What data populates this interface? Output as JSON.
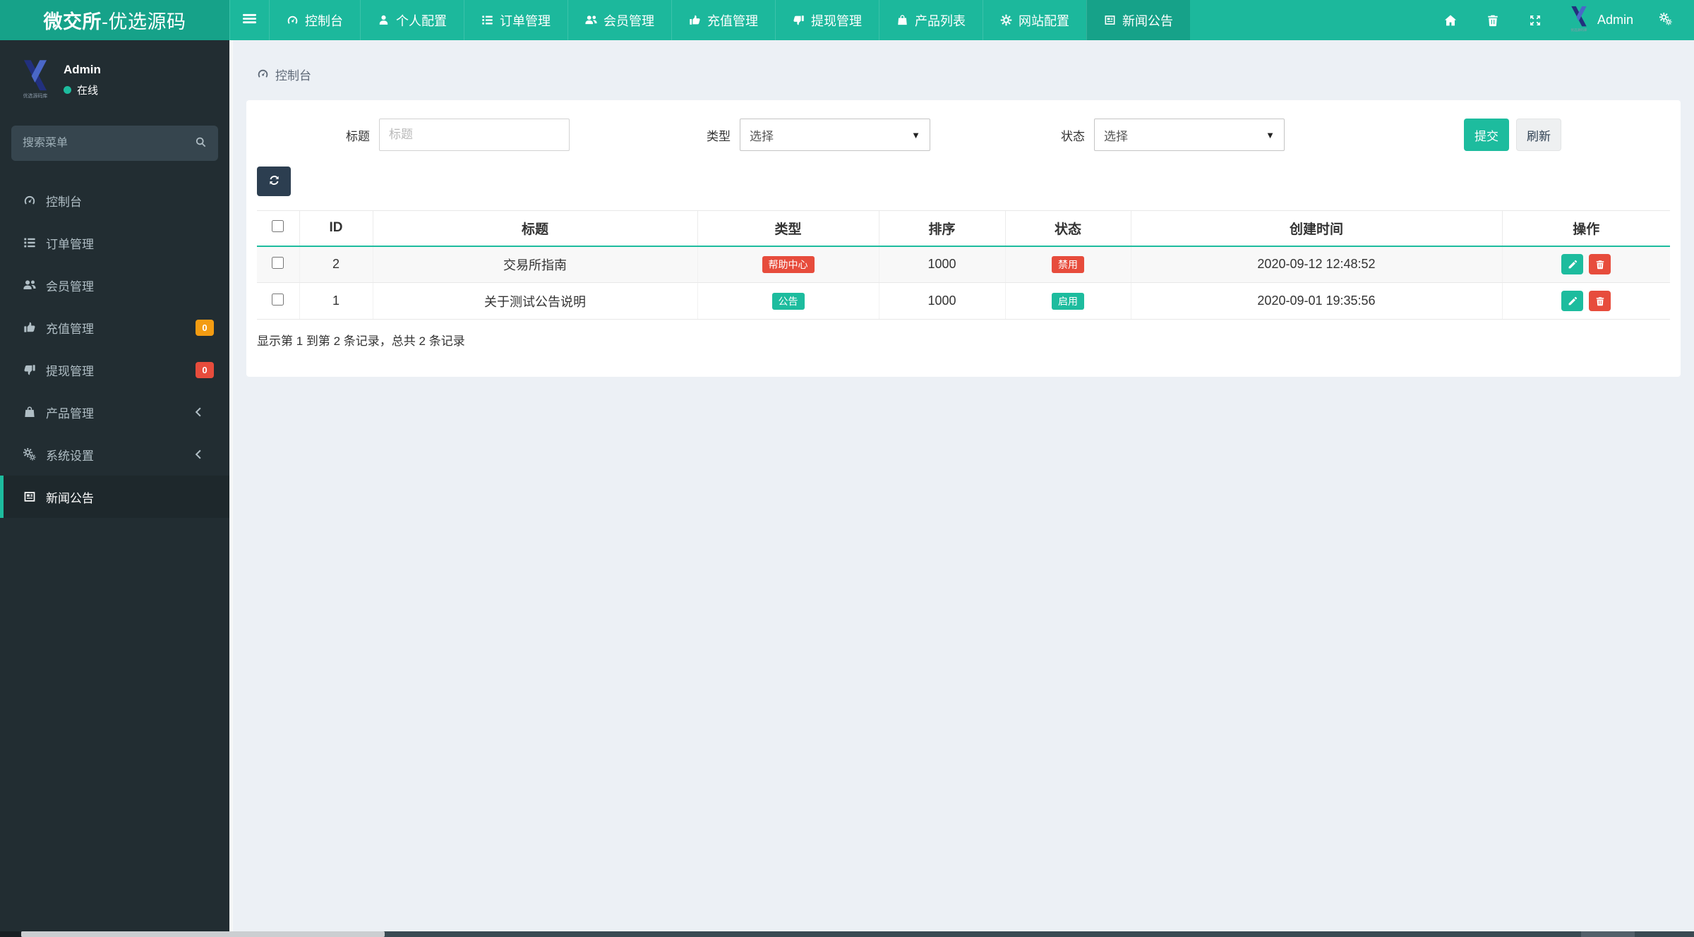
{
  "colors": {
    "teal": "#1dbc9e",
    "teal_dark": "#16a289",
    "red": "#e74c3c",
    "orange": "#f39c12",
    "navy": "#2c3e50",
    "sidebar_bg": "#222d32"
  },
  "navbar": {
    "brand_bold": "微交所",
    "brand_rest": "-优选源码",
    "items": [
      {
        "key": "dashboard",
        "label": "控制台",
        "icon": "gauge-icon",
        "active": false
      },
      {
        "key": "profile",
        "label": "个人配置",
        "icon": "user-icon",
        "active": false
      },
      {
        "key": "orders",
        "label": "订单管理",
        "icon": "list-ol-icon",
        "active": false
      },
      {
        "key": "members",
        "label": "会员管理",
        "icon": "users-icon",
        "active": false
      },
      {
        "key": "recharge",
        "label": "充值管理",
        "icon": "thumb-up-icon",
        "active": false
      },
      {
        "key": "withdraw",
        "label": "提现管理",
        "icon": "thumb-down-icon",
        "active": false
      },
      {
        "key": "products",
        "label": "产品列表",
        "icon": "bag-icon",
        "active": false
      },
      {
        "key": "site-config",
        "label": "网站配置",
        "icon": "gear-icon",
        "active": false
      },
      {
        "key": "news",
        "label": "新闻公告",
        "icon": "newspaper-icon",
        "active": true
      }
    ],
    "right_icons": [
      {
        "key": "home",
        "icon": "home-icon"
      },
      {
        "key": "trash",
        "icon": "trash-icon"
      },
      {
        "key": "fullscreen",
        "icon": "expand-icon"
      }
    ],
    "username": "Admin"
  },
  "sidebar": {
    "user_name": "Admin",
    "user_status": "在线",
    "search_placeholder": "搜索菜单",
    "items": [
      {
        "key": "dashboard",
        "label": "控制台",
        "icon": "gauge-icon"
      },
      {
        "key": "orders",
        "label": "订单管理",
        "icon": "list-ol-icon"
      },
      {
        "key": "members",
        "label": "会员管理",
        "icon": "users-icon"
      },
      {
        "key": "recharge",
        "label": "充值管理",
        "icon": "thumb-up-icon",
        "badge": "0",
        "badge_color": "#f39c12"
      },
      {
        "key": "withdraw",
        "label": "提现管理",
        "icon": "thumb-down-icon",
        "badge": "0",
        "badge_color": "#e74c3c"
      },
      {
        "key": "products",
        "label": "产品管理",
        "icon": "bag-icon",
        "has_children": true
      },
      {
        "key": "system-settings",
        "label": "系统设置",
        "icon": "cogs-icon",
        "has_children": true
      },
      {
        "key": "news",
        "label": "新闻公告",
        "icon": "newspaper-icon",
        "active": true
      }
    ]
  },
  "breadcrumb": {
    "icon": "gauge-icon",
    "label": "控制台"
  },
  "filters": {
    "title_label": "标题",
    "title_placeholder": "标题",
    "type_label": "类型",
    "type_value": "选择",
    "status_label": "状态",
    "status_value": "选择",
    "submit_label": "提交",
    "refresh_label": "刷新"
  },
  "table": {
    "headers": [
      "ID",
      "标题",
      "类型",
      "排序",
      "状态",
      "创建时间",
      "操作"
    ],
    "rows": [
      {
        "id": "2",
        "title": "交易所指南",
        "type": "帮助中心",
        "type_color": "#e74c3c",
        "sort": "1000",
        "status": "禁用",
        "status_color": "#e74c3c",
        "created": "2020-09-12 12:48:52"
      },
      {
        "id": "1",
        "title": "关于测试公告说明",
        "type": "公告",
        "type_color": "#1dbc9e",
        "sort": "1000",
        "status": "启用",
        "status_color": "#1dbc9e",
        "created": "2020-09-01 19:35:56"
      }
    ],
    "summary": "显示第 1 到第 2 条记录，总共 2 条记录"
  }
}
